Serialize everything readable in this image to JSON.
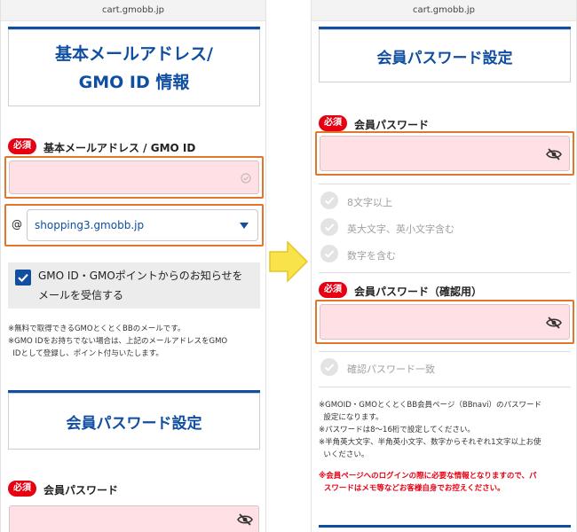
{
  "left": {
    "url": "cart.gmobb.jp",
    "title_lines": [
      "基本メールアドレス/",
      "GMO ID 情報"
    ],
    "required_badge": "必須",
    "email_label": "基本メールアドレス / GMO ID",
    "at_symbol": "@",
    "domain_select_value": "shopping3.gmobb.jp",
    "checkbox_label_lines": [
      "GMO ID・GMOポイントからのお知らせを",
      "メールを受信する"
    ],
    "notes": [
      "※無料で取得できるGMOとくとくBBのメールです。",
      "※GMO IDをお持ちでない場合は、上記のメールアドレスをGMO",
      "  IDとして登録し、ポイント付与いたします。"
    ],
    "password_section_title": "会員パスワード設定",
    "password_label": "会員パスワード"
  },
  "right": {
    "url": "cart.gmobb.jp",
    "title": "会員パスワード設定",
    "required_badge": "必須",
    "password_label": "会員パスワード",
    "requirements": [
      "8文字以上",
      "英大文字、英小文字含む",
      "数字を含む"
    ],
    "confirm_label": "会員パスワード（確認用）",
    "confirm_requirement": "確認パスワード一致",
    "notes": [
      "※GMOID・GMOとくとくBB会員ページ（BBnavi）のパスワード",
      "  設定になります。",
      "※パスワードは8〜16桁で設定してください。",
      "※半角英大文字、半角英小文字、数字からそれぞれ1文字以上お使",
      "  いください。"
    ],
    "red_notes": [
      "※会員ページへのログインの際に必要な情報となりますので、パ",
      "  スワードはメモ等などお客様自身でお控えください。"
    ]
  },
  "colors": {
    "brand_blue": "#0f4ea0",
    "required_red": "#e60012",
    "input_pink": "#ffe0e4",
    "highlight_orange": "#e2762a",
    "arrow_yellow": "#f8e34a"
  },
  "icons": {
    "eye_slash": "eye-slash-icon",
    "check_circle": "check-circle-icon",
    "dropdown": "dropdown-caret-icon",
    "arrow": "right-arrow-icon"
  }
}
